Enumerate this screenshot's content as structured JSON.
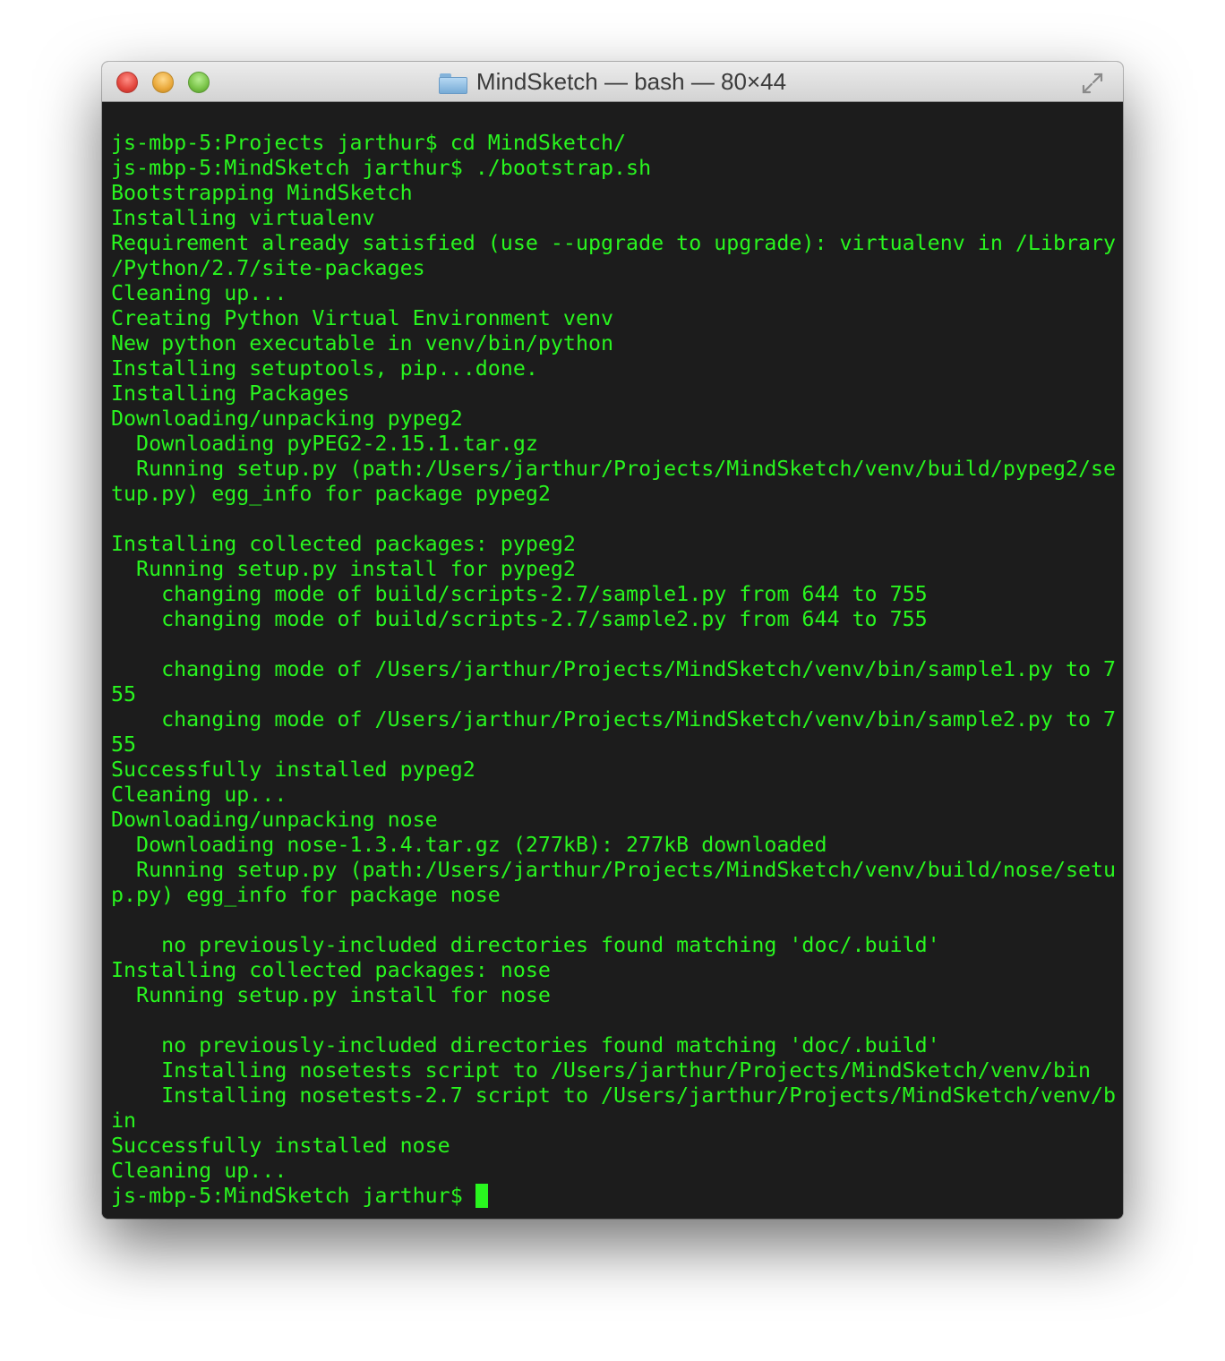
{
  "window": {
    "title": "MindSketch — bash — 80×44",
    "icons": [
      "close-button",
      "minimize-button",
      "zoom-button",
      "folder-icon",
      "fullscreen-icon"
    ]
  },
  "colors": {
    "terminal_background": "#1c1c1c",
    "terminal_text": "#29f51f",
    "cursor": "#29f51f"
  },
  "terminal": {
    "lines": [
      "js-mbp-5:Projects jarthur$ cd MindSketch/",
      "js-mbp-5:MindSketch jarthur$ ./bootstrap.sh",
      "Bootstrapping MindSketch",
      "Installing virtualenv",
      "Requirement already satisfied (use --upgrade to upgrade): virtualenv in /Library",
      "/Python/2.7/site-packages",
      "Cleaning up...",
      "Creating Python Virtual Environment venv",
      "New python executable in venv/bin/python",
      "Installing setuptools, pip...done.",
      "Installing Packages",
      "Downloading/unpacking pypeg2",
      "  Downloading pyPEG2-2.15.1.tar.gz",
      "  Running setup.py (path:/Users/jarthur/Projects/MindSketch/venv/build/pypeg2/se",
      "tup.py) egg_info for package pypeg2",
      "",
      "Installing collected packages: pypeg2",
      "  Running setup.py install for pypeg2",
      "    changing mode of build/scripts-2.7/sample1.py from 644 to 755",
      "    changing mode of build/scripts-2.7/sample2.py from 644 to 755",
      "",
      "    changing mode of /Users/jarthur/Projects/MindSketch/venv/bin/sample1.py to 7",
      "55",
      "    changing mode of /Users/jarthur/Projects/MindSketch/venv/bin/sample2.py to 7",
      "55",
      "Successfully installed pypeg2",
      "Cleaning up...",
      "Downloading/unpacking nose",
      "  Downloading nose-1.3.4.tar.gz (277kB): 277kB downloaded",
      "  Running setup.py (path:/Users/jarthur/Projects/MindSketch/venv/build/nose/setu",
      "p.py) egg_info for package nose",
      "",
      "    no previously-included directories found matching 'doc/.build'",
      "Installing collected packages: nose",
      "  Running setup.py install for nose",
      "",
      "    no previously-included directories found matching 'doc/.build'",
      "    Installing nosetests script to /Users/jarthur/Projects/MindSketch/venv/bin",
      "    Installing nosetests-2.7 script to /Users/jarthur/Projects/MindSketch/venv/b",
      "in",
      "Successfully installed nose",
      "Cleaning up..."
    ],
    "prompt": "js-mbp-5:MindSketch jarthur$ "
  }
}
